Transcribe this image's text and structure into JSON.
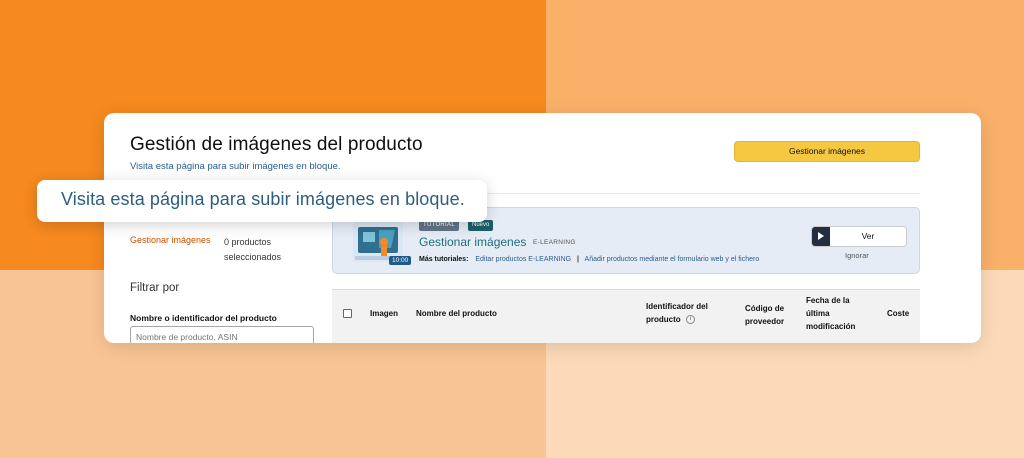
{
  "colors": {
    "bg_orange": "#f6891f",
    "bg_light_orange": "#f9b16a",
    "bg_peach": "#f9c493",
    "bg_pale": "#fcd9b8",
    "accent_button": "#f5c842",
    "link": "#2a5d8f",
    "side_link": "#c45500",
    "tutorial_title": "#1c6f7c"
  },
  "header": {
    "title": "Gestión de imágenes del producto",
    "subtitle": "Visita esta página para subir imágenes en bloque.",
    "manage_button": "Gestionar imágenes"
  },
  "sidebar": {
    "link": "Gestionar imágenes",
    "selected_count": "0 productos seleccionados",
    "filter_title": "Filtrar por",
    "filter_label": "Nombre o identificador del producto",
    "filter_placeholder": "Nombre de producto, ASIN"
  },
  "tutorial": {
    "badge_tutorial": "TUTORIAL",
    "badge_new": "Nuevo",
    "title": "Gestionar imágenes",
    "tag": "E-LEARNING",
    "duration": "10:00",
    "more_label": "Más tutoriales:",
    "links": [
      "Editar productos E-LEARNING",
      "Añadir productos mediante el formulario web y el fichero"
    ],
    "separator": "|",
    "watch_button": "Ver",
    "ignore_button": "Ignorar",
    "icons": [
      "video-thumbnail-icon",
      "play-icon"
    ]
  },
  "table": {
    "columns": [
      "Imagen",
      "Nombre del producto",
      "Identificador del producto",
      "Código de proveedor",
      "Fecha de la última modificación",
      "Coste"
    ],
    "icons": [
      "checkbox-icon",
      "info-icon"
    ],
    "info_icon_glyph": "i"
  },
  "callout": {
    "text": "Visita esta página para subir imágenes en bloque."
  }
}
